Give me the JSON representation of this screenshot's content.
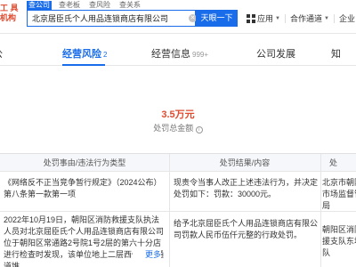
{
  "header": {
    "logo_lines": [
      "工 具",
      "机构"
    ],
    "search_tabs": [
      {
        "label": "查公司",
        "active": true
      },
      {
        "label": "查老板",
        "active": false
      },
      {
        "label": "查风险",
        "active": false
      },
      {
        "label": "查关系",
        "active": false
      }
    ],
    "search": {
      "value": "北京居臣氏个人用品连锁商店有限公司"
    },
    "search_button": "天眼一下",
    "nav": {
      "apps": "应用",
      "cooperation": "合作通道",
      "enterprise": "企业"
    }
  },
  "dimension_tabs": [
    {
      "label": "公",
      "count": ""
    },
    {
      "label": "经营风险",
      "count": "2"
    },
    {
      "label": "经营信息",
      "count": "999+"
    },
    {
      "label": "公司发展",
      "count": ""
    },
    {
      "label": "知",
      "count": ""
    }
  ],
  "summary": {
    "amount": "3.5万元",
    "amount_label": "处罚总金额"
  },
  "table": {
    "headers": [
      "处罚事由/违法行为类型",
      "处罚结果/内容",
      "处"
    ],
    "rows": [
      {
        "reason": "《网络反不正当竞争暂行规定》（2024公布）第八条第一款第一项",
        "result": "现责令当事人改正上述违法行为，并决定处罚如下：罚款：30000元。",
        "authority": "北京市朝阳区市场监督管理局"
      },
      {
        "reason": "2022年10月19日，朝阳区消防救援支队执法人员对北京屈臣氏个人用品连锁商店有限公司位于朝阳区常通路2号院1号2层的第六十分店进行检查时发现，该单位地上二层西侧疏散通道堆",
        "more": "更多",
        "result": "给予北京屈臣氏个人用品连锁商店有限公司罚款人民币伍仟元整的行政处罚。",
        "authority": "朝阳区消防救援支队东坝大队"
      }
    ]
  },
  "colors": {
    "accent": "#1a6dea",
    "amount": "#e04a2f",
    "header_bg": "#f5f7fa"
  }
}
